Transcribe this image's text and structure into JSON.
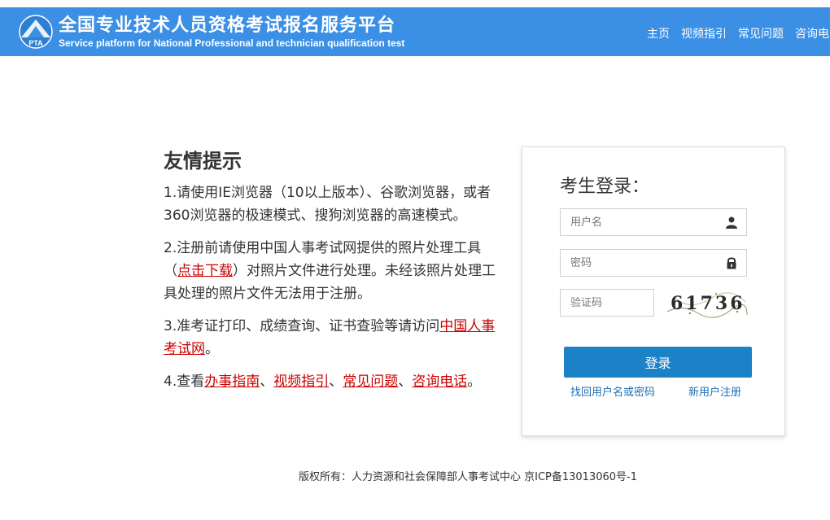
{
  "header": {
    "title": "全国专业技术人员资格考试报名服务平台",
    "subtitle": "Service platform for National Professional and technician qualification test",
    "logo_text": "PTA",
    "nav": [
      "主页",
      "视频指引",
      "常见问题",
      "咨询电"
    ]
  },
  "tips": {
    "title": "友情提示",
    "tip1": "1.请使用IE浏览器（10以上版本）、谷歌浏览器，或者360浏览器的极速模式、搜狗浏览器的高速模式。",
    "tip2_a": "2.注册前请使用中国人事考试网提供的照片处理工具（",
    "tip2_link": "点击下载",
    "tip2_b": "）对照片文件进行处理。未经该照片处理工具处理的照片文件无法用于注册。",
    "tip3_a": "3.准考证打印、成绩查询、证书查验等请访问",
    "tip3_link": "中国人事考试网",
    "tip3_b": "。",
    "tip4_a": "4.查看",
    "tip4_links": [
      "办事指南",
      "视频指引",
      "常见问题",
      "咨询电话"
    ],
    "tip4_sep": "、",
    "tip4_end": "。"
  },
  "login": {
    "title": "考生登录：",
    "username_placeholder": "用户名",
    "password_placeholder": "密码",
    "captcha_placeholder": "验证码",
    "captcha_text": "61736",
    "submit_label": "登录",
    "forgot_label": "找回用户名或密码",
    "register_label": "新用户注册"
  },
  "footer": {
    "text": "版权所有：人力资源和社会保障部人事考试中心 京ICP备13013060号-1"
  },
  "colors": {
    "header_bg": "#3b8fe4",
    "link_red": "#cc0000",
    "button_blue": "#1b82c8"
  },
  "icons": [
    "pta-logo-icon",
    "user-icon",
    "lock-icon"
  ]
}
